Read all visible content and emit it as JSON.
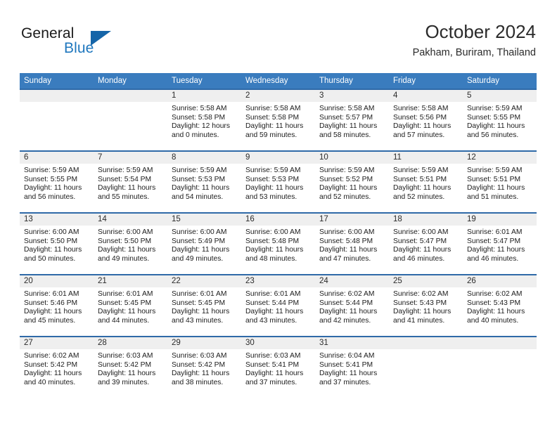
{
  "brand": {
    "name_part1": "General",
    "name_part2": "Blue",
    "accent_color": "#1f77be",
    "triangle_color": "#1565a8"
  },
  "header": {
    "title": "October 2024",
    "subtitle": "Pakham, Buriram, Thailand"
  },
  "calendar": {
    "header_bg": "#3a7cbe",
    "row_separator": "#2f6aa8",
    "day_band_bg": "#efefef",
    "weekdays": [
      "Sunday",
      "Monday",
      "Tuesday",
      "Wednesday",
      "Thursday",
      "Friday",
      "Saturday"
    ],
    "weeks": [
      [
        {
          "day": "",
          "sunrise": "",
          "sunset": "",
          "daylight_line1": "",
          "daylight_line2": ""
        },
        {
          "day": "",
          "sunrise": "",
          "sunset": "",
          "daylight_line1": "",
          "daylight_line2": ""
        },
        {
          "day": "1",
          "sunrise": "Sunrise: 5:58 AM",
          "sunset": "Sunset: 5:58 PM",
          "daylight_line1": "Daylight: 12 hours",
          "daylight_line2": "and 0 minutes."
        },
        {
          "day": "2",
          "sunrise": "Sunrise: 5:58 AM",
          "sunset": "Sunset: 5:58 PM",
          "daylight_line1": "Daylight: 11 hours",
          "daylight_line2": "and 59 minutes."
        },
        {
          "day": "3",
          "sunrise": "Sunrise: 5:58 AM",
          "sunset": "Sunset: 5:57 PM",
          "daylight_line1": "Daylight: 11 hours",
          "daylight_line2": "and 58 minutes."
        },
        {
          "day": "4",
          "sunrise": "Sunrise: 5:58 AM",
          "sunset": "Sunset: 5:56 PM",
          "daylight_line1": "Daylight: 11 hours",
          "daylight_line2": "and 57 minutes."
        },
        {
          "day": "5",
          "sunrise": "Sunrise: 5:59 AM",
          "sunset": "Sunset: 5:55 PM",
          "daylight_line1": "Daylight: 11 hours",
          "daylight_line2": "and 56 minutes."
        }
      ],
      [
        {
          "day": "6",
          "sunrise": "Sunrise: 5:59 AM",
          "sunset": "Sunset: 5:55 PM",
          "daylight_line1": "Daylight: 11 hours",
          "daylight_line2": "and 56 minutes."
        },
        {
          "day": "7",
          "sunrise": "Sunrise: 5:59 AM",
          "sunset": "Sunset: 5:54 PM",
          "daylight_line1": "Daylight: 11 hours",
          "daylight_line2": "and 55 minutes."
        },
        {
          "day": "8",
          "sunrise": "Sunrise: 5:59 AM",
          "sunset": "Sunset: 5:53 PM",
          "daylight_line1": "Daylight: 11 hours",
          "daylight_line2": "and 54 minutes."
        },
        {
          "day": "9",
          "sunrise": "Sunrise: 5:59 AM",
          "sunset": "Sunset: 5:53 PM",
          "daylight_line1": "Daylight: 11 hours",
          "daylight_line2": "and 53 minutes."
        },
        {
          "day": "10",
          "sunrise": "Sunrise: 5:59 AM",
          "sunset": "Sunset: 5:52 PM",
          "daylight_line1": "Daylight: 11 hours",
          "daylight_line2": "and 52 minutes."
        },
        {
          "day": "11",
          "sunrise": "Sunrise: 5:59 AM",
          "sunset": "Sunset: 5:51 PM",
          "daylight_line1": "Daylight: 11 hours",
          "daylight_line2": "and 52 minutes."
        },
        {
          "day": "12",
          "sunrise": "Sunrise: 5:59 AM",
          "sunset": "Sunset: 5:51 PM",
          "daylight_line1": "Daylight: 11 hours",
          "daylight_line2": "and 51 minutes."
        }
      ],
      [
        {
          "day": "13",
          "sunrise": "Sunrise: 6:00 AM",
          "sunset": "Sunset: 5:50 PM",
          "daylight_line1": "Daylight: 11 hours",
          "daylight_line2": "and 50 minutes."
        },
        {
          "day": "14",
          "sunrise": "Sunrise: 6:00 AM",
          "sunset": "Sunset: 5:50 PM",
          "daylight_line1": "Daylight: 11 hours",
          "daylight_line2": "and 49 minutes."
        },
        {
          "day": "15",
          "sunrise": "Sunrise: 6:00 AM",
          "sunset": "Sunset: 5:49 PM",
          "daylight_line1": "Daylight: 11 hours",
          "daylight_line2": "and 49 minutes."
        },
        {
          "day": "16",
          "sunrise": "Sunrise: 6:00 AM",
          "sunset": "Sunset: 5:48 PM",
          "daylight_line1": "Daylight: 11 hours",
          "daylight_line2": "and 48 minutes."
        },
        {
          "day": "17",
          "sunrise": "Sunrise: 6:00 AM",
          "sunset": "Sunset: 5:48 PM",
          "daylight_line1": "Daylight: 11 hours",
          "daylight_line2": "and 47 minutes."
        },
        {
          "day": "18",
          "sunrise": "Sunrise: 6:00 AM",
          "sunset": "Sunset: 5:47 PM",
          "daylight_line1": "Daylight: 11 hours",
          "daylight_line2": "and 46 minutes."
        },
        {
          "day": "19",
          "sunrise": "Sunrise: 6:01 AM",
          "sunset": "Sunset: 5:47 PM",
          "daylight_line1": "Daylight: 11 hours",
          "daylight_line2": "and 46 minutes."
        }
      ],
      [
        {
          "day": "20",
          "sunrise": "Sunrise: 6:01 AM",
          "sunset": "Sunset: 5:46 PM",
          "daylight_line1": "Daylight: 11 hours",
          "daylight_line2": "and 45 minutes."
        },
        {
          "day": "21",
          "sunrise": "Sunrise: 6:01 AM",
          "sunset": "Sunset: 5:45 PM",
          "daylight_line1": "Daylight: 11 hours",
          "daylight_line2": "and 44 minutes."
        },
        {
          "day": "22",
          "sunrise": "Sunrise: 6:01 AM",
          "sunset": "Sunset: 5:45 PM",
          "daylight_line1": "Daylight: 11 hours",
          "daylight_line2": "and 43 minutes."
        },
        {
          "day": "23",
          "sunrise": "Sunrise: 6:01 AM",
          "sunset": "Sunset: 5:44 PM",
          "daylight_line1": "Daylight: 11 hours",
          "daylight_line2": "and 43 minutes."
        },
        {
          "day": "24",
          "sunrise": "Sunrise: 6:02 AM",
          "sunset": "Sunset: 5:44 PM",
          "daylight_line1": "Daylight: 11 hours",
          "daylight_line2": "and 42 minutes."
        },
        {
          "day": "25",
          "sunrise": "Sunrise: 6:02 AM",
          "sunset": "Sunset: 5:43 PM",
          "daylight_line1": "Daylight: 11 hours",
          "daylight_line2": "and 41 minutes."
        },
        {
          "day": "26",
          "sunrise": "Sunrise: 6:02 AM",
          "sunset": "Sunset: 5:43 PM",
          "daylight_line1": "Daylight: 11 hours",
          "daylight_line2": "and 40 minutes."
        }
      ],
      [
        {
          "day": "27",
          "sunrise": "Sunrise: 6:02 AM",
          "sunset": "Sunset: 5:42 PM",
          "daylight_line1": "Daylight: 11 hours",
          "daylight_line2": "and 40 minutes."
        },
        {
          "day": "28",
          "sunrise": "Sunrise: 6:03 AM",
          "sunset": "Sunset: 5:42 PM",
          "daylight_line1": "Daylight: 11 hours",
          "daylight_line2": "and 39 minutes."
        },
        {
          "day": "29",
          "sunrise": "Sunrise: 6:03 AM",
          "sunset": "Sunset: 5:42 PM",
          "daylight_line1": "Daylight: 11 hours",
          "daylight_line2": "and 38 minutes."
        },
        {
          "day": "30",
          "sunrise": "Sunrise: 6:03 AM",
          "sunset": "Sunset: 5:41 PM",
          "daylight_line1": "Daylight: 11 hours",
          "daylight_line2": "and 37 minutes."
        },
        {
          "day": "31",
          "sunrise": "Sunrise: 6:04 AM",
          "sunset": "Sunset: 5:41 PM",
          "daylight_line1": "Daylight: 11 hours",
          "daylight_line2": "and 37 minutes."
        },
        {
          "day": "",
          "sunrise": "",
          "sunset": "",
          "daylight_line1": "",
          "daylight_line2": ""
        },
        {
          "day": "",
          "sunrise": "",
          "sunset": "",
          "daylight_line1": "",
          "daylight_line2": ""
        }
      ]
    ]
  }
}
